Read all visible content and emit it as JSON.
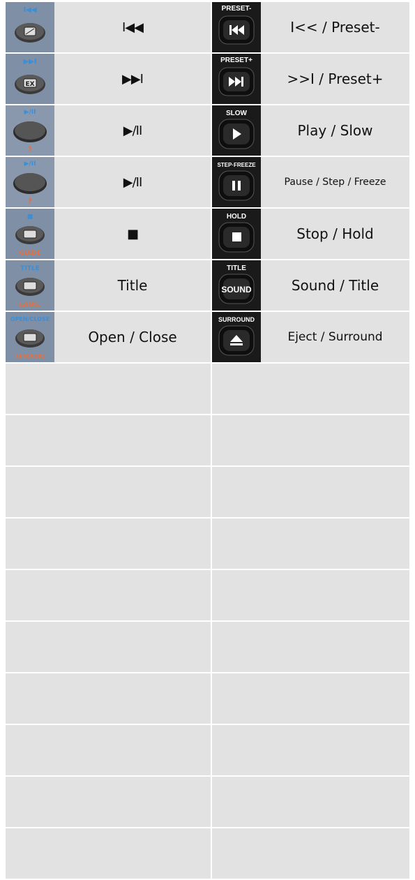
{
  "rows": [
    {
      "left_thumb": {
        "top_text": "I◀◀",
        "bottom_text": "",
        "icon": "old-remote-prev-button"
      },
      "left_label": "I◀◀",
      "right_thumb": {
        "top_text": "PRESET-",
        "icon": "skip-back-icon"
      },
      "right_label": "I<< / Preset-"
    },
    {
      "left_thumb": {
        "top_text": "▶▶I",
        "bottom_text": "",
        "icon": "old-remote-next-button"
      },
      "left_label": "▶▶I",
      "right_thumb": {
        "top_text": "PRESET+",
        "icon": "skip-forward-icon"
      },
      "right_label": ">>I / Preset+"
    },
    {
      "left_thumb": {
        "top_text": "▶/II",
        "bottom_text": "?",
        "icon": "old-remote-play-pause-button"
      },
      "left_label": "▶/II",
      "right_thumb": {
        "top_text": "SLOW",
        "icon": "play-icon"
      },
      "right_label": "Play / Slow"
    },
    {
      "left_thumb": {
        "top_text": "▶/II",
        "bottom_text": "?",
        "icon": "old-remote-play-pause-button"
      },
      "left_label": "▶/II",
      "right_thumb": {
        "top_text": "STEP·FREEZE",
        "icon": "pause-icon"
      },
      "right_label": "Pause / Step / Freeze"
    },
    {
      "left_thumb": {
        "top_text": "■",
        "bottom_text": "GUIDE",
        "icon": "old-remote-stop-button"
      },
      "left_label": "■",
      "right_thumb": {
        "top_text": "HOLD",
        "icon": "stop-icon"
      },
      "right_label": "Stop / Hold"
    },
    {
      "left_thumb": {
        "top_text": "TITLE",
        "bottom_text": "LANG.",
        "icon": "old-remote-title-button"
      },
      "left_label": "Title",
      "right_thumb": {
        "top_text": "TITLE",
        "icon": "sound-button-icon",
        "button_text": "SOUND"
      },
      "right_label": "Sound / Title"
    },
    {
      "left_thumb": {
        "top_text": "OPEN/CLOSE",
        "bottom_text": "TV/RADIO",
        "icon": "old-remote-open-close-button"
      },
      "left_label": "Open / Close",
      "right_thumb": {
        "top_text": "SURROUND",
        "icon": "eject-icon"
      },
      "right_label": "Eject / Surround"
    }
  ],
  "empty_row_count": 10,
  "colors": {
    "cell_bg": "#e2e2e2",
    "remote_top_text": "#3a8fd6",
    "remote_bottom_text": "#e07040",
    "new_remote_bg": "#1a1a1a"
  }
}
